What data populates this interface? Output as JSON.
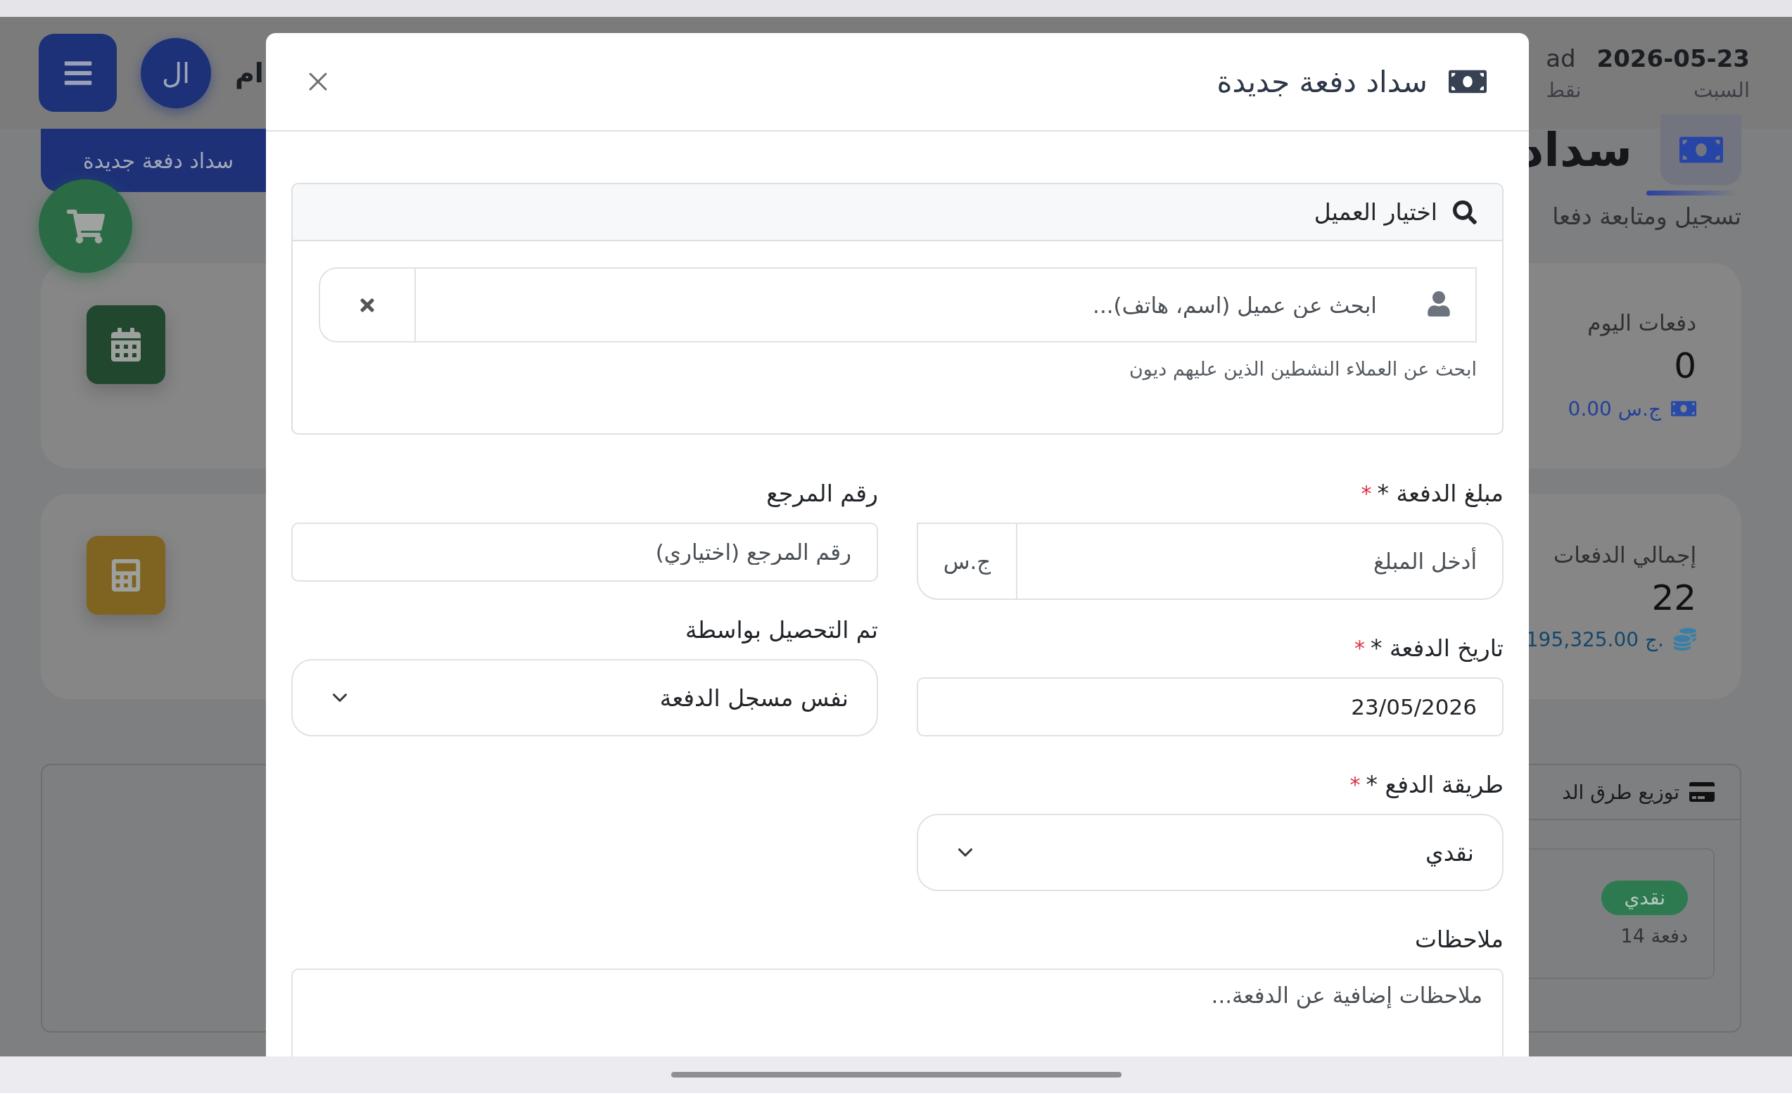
{
  "header": {
    "avatar": "ال",
    "name_fragment": "ام",
    "user_fragment": "ad",
    "user_sub_fragment": "نقط",
    "date": "2026-05-23",
    "day": "السبت"
  },
  "page": {
    "title": "سداد",
    "subtitle": "تسجيل ومتابعة دفعا",
    "new_payment_button": "سداد دفعة جديدة"
  },
  "stats": [
    {
      "kind": "today",
      "label": "دفعات اليوم",
      "value": "0",
      "amount": "0.00 ج.س"
    },
    {
      "kind": "total",
      "label": "إجمالي الدفعات",
      "value": "22",
      "amount": "195,325.00 ج."
    }
  ],
  "methods_panel": {
    "title": "توزيع طرق الد",
    "methods": [
      {
        "name": "نقدي",
        "count": "14 دفعة",
        "color": "#2e7a50"
      }
    ]
  },
  "modal": {
    "title": "سداد دفعة جديدة",
    "customer": {
      "header": "اختيار العميل",
      "placeholder": "ابحث عن عميل (اسم، هاتف)...",
      "help": "ابحث عن العملاء النشطين الذين عليهم ديون"
    },
    "fields_right": [
      {
        "kind": "amount",
        "label": "مبلغ الدفعة *",
        "required_mark": "*",
        "placeholder": "أدخل المبلغ",
        "addon": "ج.س"
      },
      {
        "kind": "date",
        "label": "تاريخ الدفعة *",
        "required_mark": "*",
        "value": "23/05/2026"
      },
      {
        "kind": "select",
        "label": "طريقة الدفع *",
        "required_mark": "*",
        "value": "نقدي"
      }
    ],
    "fields_left": [
      {
        "kind": "text",
        "label": "رقم المرجع",
        "placeholder": "رقم المرجع (اختياري)"
      },
      {
        "kind": "select",
        "label": "تم التحصيل بواسطة",
        "value": "نفس مسجل الدفعة"
      }
    ],
    "notes": {
      "label": "ملاحظات",
      "placeholder": "ملاحظات إضافية عن الدفعة..."
    }
  }
}
